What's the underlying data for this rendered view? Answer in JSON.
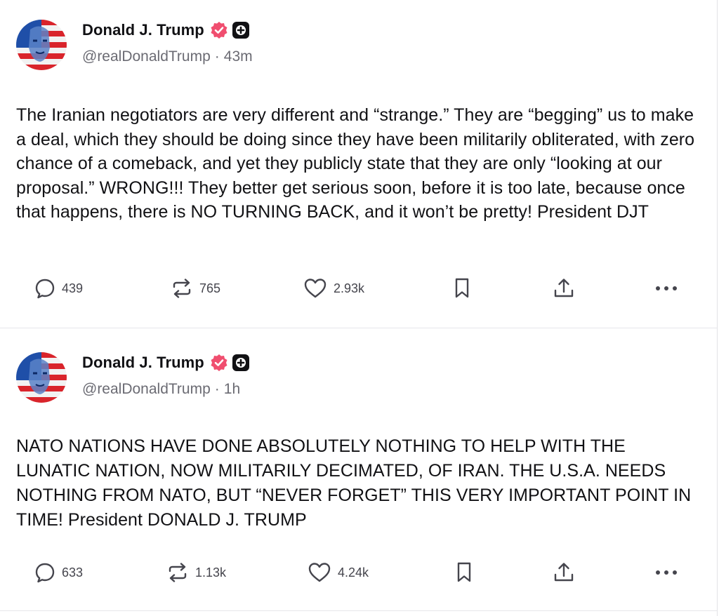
{
  "posts": [
    {
      "author_name": "Donald J. Trump",
      "handle": "@realDonaldTrump",
      "separator": "·",
      "time": "43m",
      "text": "The Iranian negotiators are very different and “strange.” They are “begging” us to make a deal, which they should be doing since they have been militarily obliterated, with zero chance of a comeback, and yet they publicly state that they are only “looking at our proposal.” WRONG!!! They better get serious soon, before it is too late, because once that happens, there is NO TURNING BACK, and it won’t be pretty! President DJT",
      "replies": "439",
      "reposts": "765",
      "likes": "2.93k"
    },
    {
      "author_name": "Donald J. Trump",
      "handle": "@realDonaldTrump",
      "separator": "·",
      "time": "1h",
      "text": "NATO NATIONS HAVE DONE ABSOLUTELY NOTHING TO HELP WITH THE LUNATIC NATION, NOW MILITARILY DECIMATED, OF IRAN. THE U.S.A. NEEDS NOTHING FROM NATO, BUT “NEVER FORGET” THIS VERY IMPORTANT POINT IN TIME! President DONALD J. TRUMP",
      "replies": "633",
      "reposts": "1.13k",
      "likes": "4.24k"
    }
  ],
  "icons": {
    "verified": "verified-badge-icon",
    "plus": "plus-badge-icon",
    "reply": "speech-bubble-icon",
    "repost": "repost-arrows-icon",
    "like": "heart-icon",
    "bookmark": "bookmark-icon",
    "share": "share-upload-icon",
    "more": "ellipsis-icon"
  },
  "colors": {
    "verified": "#f04e6f",
    "text": "#111114",
    "muted": "#6b6b73",
    "icon": "#45454d"
  }
}
